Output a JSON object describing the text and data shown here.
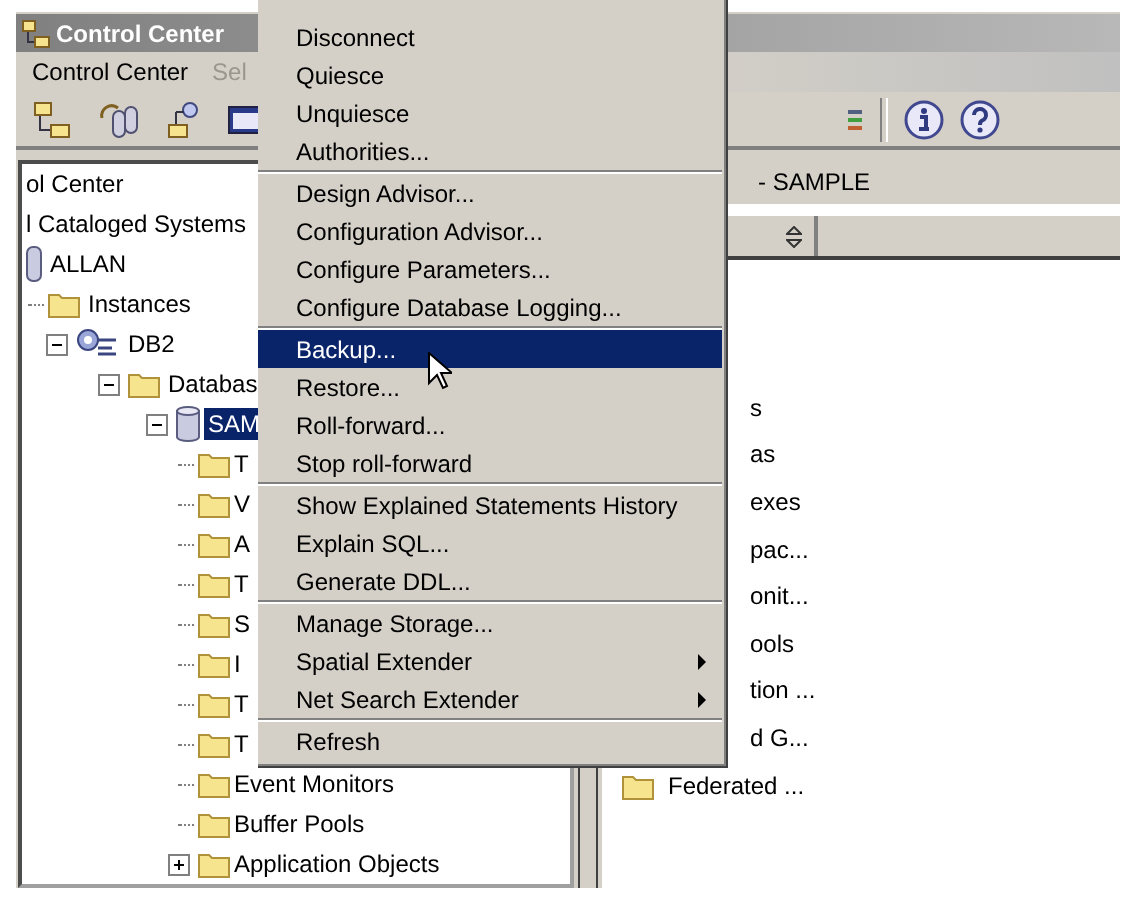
{
  "window": {
    "title": "Control Center"
  },
  "menubar": [
    {
      "label": "Control Center",
      "disabled": false
    },
    {
      "label": "Sel",
      "disabled": true
    }
  ],
  "tree": [
    {
      "label": "ol Center",
      "selected": false,
      "children": [
        {
          "label": "l Cataloged Systems",
          "selected": false,
          "children": [
            {
              "label": "ALLAN",
              "kind": "system",
              "selected": false,
              "children": [
                {
                  "label": "Instances",
                  "kind": "folder",
                  "selected": false,
                  "children": [
                    {
                      "label": "DB2",
                      "kind": "instance",
                      "expanded": true,
                      "selected": false,
                      "children": [
                        {
                          "label": "Databas",
                          "kind": "folder",
                          "expanded": true,
                          "selected": false,
                          "children": [
                            {
                              "label": "SAM",
                              "kind": "database",
                              "expanded": true,
                              "selected": true,
                              "children": [
                                {
                                  "label": "T",
                                  "kind": "folder",
                                  "selected": false
                                },
                                {
                                  "label": "V",
                                  "kind": "folder",
                                  "selected": false
                                },
                                {
                                  "label": "A",
                                  "kind": "folder",
                                  "selected": false
                                },
                                {
                                  "label": "T",
                                  "kind": "folder",
                                  "selected": false
                                },
                                {
                                  "label": "S",
                                  "kind": "folder",
                                  "selected": false
                                },
                                {
                                  "label": "I",
                                  "kind": "folder",
                                  "selected": false
                                },
                                {
                                  "label": "T",
                                  "kind": "folder",
                                  "selected": false
                                },
                                {
                                  "label": "T",
                                  "kind": "folder",
                                  "selected": false
                                },
                                {
                                  "label": "Event Monitors",
                                  "kind": "folder",
                                  "selected": false
                                },
                                {
                                  "label": "Buffer Pools",
                                  "kind": "folder",
                                  "selected": false
                                },
                                {
                                  "label": "Application Objects",
                                  "kind": "folder",
                                  "expanded": false,
                                  "selected": false
                                }
                              ]
                            }
                          ]
                        }
                      ]
                    }
                  ]
                }
              ]
            }
          ]
        }
      ]
    }
  ],
  "content": {
    "title": "- SAMPLE",
    "items": [
      {
        "label": "s",
        "kind": "partial"
      },
      {
        "label": "as",
        "kind": "partial"
      },
      {
        "label": "exes",
        "kind": "partial"
      },
      {
        "label": "pac...",
        "kind": "partial"
      },
      {
        "label": "onit...",
        "kind": "partial"
      },
      {
        "label": "ools",
        "kind": "partial"
      },
      {
        "label": "tion ...",
        "kind": "partial"
      },
      {
        "label": "d G...",
        "kind": "partial"
      },
      {
        "label": "Federated ...",
        "kind": "folder"
      }
    ]
  },
  "context_menu": {
    "groups": [
      [
        {
          "label": "Disconnect",
          "selected": false,
          "submenu": false
        },
        {
          "label": "Quiesce",
          "selected": false,
          "submenu": false
        },
        {
          "label": "Unquiesce",
          "selected": false,
          "submenu": false
        },
        {
          "label": "Authorities...",
          "selected": false,
          "submenu": false
        }
      ],
      [
        {
          "label": "Design Advisor...",
          "selected": false,
          "submenu": false
        },
        {
          "label": "Configuration Advisor...",
          "selected": false,
          "submenu": false
        },
        {
          "label": "Configure Parameters...",
          "selected": false,
          "submenu": false
        },
        {
          "label": "Configure Database Logging...",
          "selected": false,
          "submenu": false
        }
      ],
      [
        {
          "label": "Backup...",
          "selected": true,
          "submenu": false
        },
        {
          "label": "Restore...",
          "selected": false,
          "submenu": false
        },
        {
          "label": "Roll-forward...",
          "selected": false,
          "submenu": false
        },
        {
          "label": "Stop roll-forward",
          "selected": false,
          "submenu": false
        }
      ],
      [
        {
          "label": "Show Explained Statements History",
          "selected": false,
          "submenu": false
        },
        {
          "label": "Explain SQL...",
          "selected": false,
          "submenu": false
        },
        {
          "label": "Generate DDL...",
          "selected": false,
          "submenu": false
        }
      ],
      [
        {
          "label": "Manage Storage...",
          "selected": false,
          "submenu": false
        },
        {
          "label": "Spatial Extender",
          "selected": false,
          "submenu": true
        },
        {
          "label": "Net Search Extender",
          "selected": false,
          "submenu": true
        }
      ],
      [
        {
          "label": "Refresh",
          "selected": false,
          "submenu": false
        }
      ]
    ]
  }
}
